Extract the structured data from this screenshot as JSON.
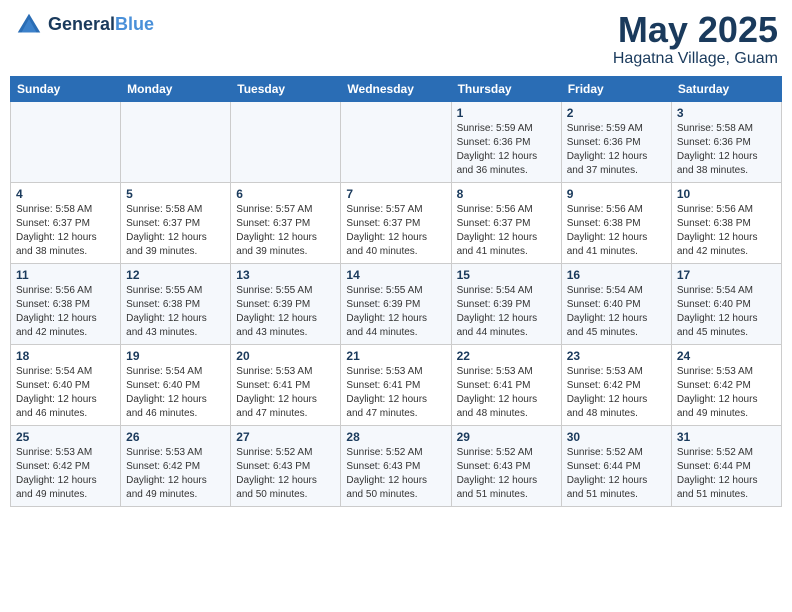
{
  "header": {
    "logo_line1": "General",
    "logo_line2": "Blue",
    "month": "May 2025",
    "location": "Hagatna Village, Guam"
  },
  "weekdays": [
    "Sunday",
    "Monday",
    "Tuesday",
    "Wednesday",
    "Thursday",
    "Friday",
    "Saturday"
  ],
  "weeks": [
    [
      {
        "day": "",
        "info": ""
      },
      {
        "day": "",
        "info": ""
      },
      {
        "day": "",
        "info": ""
      },
      {
        "day": "",
        "info": ""
      },
      {
        "day": "1",
        "info": "Sunrise: 5:59 AM\nSunset: 6:36 PM\nDaylight: 12 hours\nand 36 minutes."
      },
      {
        "day": "2",
        "info": "Sunrise: 5:59 AM\nSunset: 6:36 PM\nDaylight: 12 hours\nand 37 minutes."
      },
      {
        "day": "3",
        "info": "Sunrise: 5:58 AM\nSunset: 6:36 PM\nDaylight: 12 hours\nand 38 minutes."
      }
    ],
    [
      {
        "day": "4",
        "info": "Sunrise: 5:58 AM\nSunset: 6:37 PM\nDaylight: 12 hours\nand 38 minutes."
      },
      {
        "day": "5",
        "info": "Sunrise: 5:58 AM\nSunset: 6:37 PM\nDaylight: 12 hours\nand 39 minutes."
      },
      {
        "day": "6",
        "info": "Sunrise: 5:57 AM\nSunset: 6:37 PM\nDaylight: 12 hours\nand 39 minutes."
      },
      {
        "day": "7",
        "info": "Sunrise: 5:57 AM\nSunset: 6:37 PM\nDaylight: 12 hours\nand 40 minutes."
      },
      {
        "day": "8",
        "info": "Sunrise: 5:56 AM\nSunset: 6:37 PM\nDaylight: 12 hours\nand 41 minutes."
      },
      {
        "day": "9",
        "info": "Sunrise: 5:56 AM\nSunset: 6:38 PM\nDaylight: 12 hours\nand 41 minutes."
      },
      {
        "day": "10",
        "info": "Sunrise: 5:56 AM\nSunset: 6:38 PM\nDaylight: 12 hours\nand 42 minutes."
      }
    ],
    [
      {
        "day": "11",
        "info": "Sunrise: 5:56 AM\nSunset: 6:38 PM\nDaylight: 12 hours\nand 42 minutes."
      },
      {
        "day": "12",
        "info": "Sunrise: 5:55 AM\nSunset: 6:38 PM\nDaylight: 12 hours\nand 43 minutes."
      },
      {
        "day": "13",
        "info": "Sunrise: 5:55 AM\nSunset: 6:39 PM\nDaylight: 12 hours\nand 43 minutes."
      },
      {
        "day": "14",
        "info": "Sunrise: 5:55 AM\nSunset: 6:39 PM\nDaylight: 12 hours\nand 44 minutes."
      },
      {
        "day": "15",
        "info": "Sunrise: 5:54 AM\nSunset: 6:39 PM\nDaylight: 12 hours\nand 44 minutes."
      },
      {
        "day": "16",
        "info": "Sunrise: 5:54 AM\nSunset: 6:40 PM\nDaylight: 12 hours\nand 45 minutes."
      },
      {
        "day": "17",
        "info": "Sunrise: 5:54 AM\nSunset: 6:40 PM\nDaylight: 12 hours\nand 45 minutes."
      }
    ],
    [
      {
        "day": "18",
        "info": "Sunrise: 5:54 AM\nSunset: 6:40 PM\nDaylight: 12 hours\nand 46 minutes."
      },
      {
        "day": "19",
        "info": "Sunrise: 5:54 AM\nSunset: 6:40 PM\nDaylight: 12 hours\nand 46 minutes."
      },
      {
        "day": "20",
        "info": "Sunrise: 5:53 AM\nSunset: 6:41 PM\nDaylight: 12 hours\nand 47 minutes."
      },
      {
        "day": "21",
        "info": "Sunrise: 5:53 AM\nSunset: 6:41 PM\nDaylight: 12 hours\nand 47 minutes."
      },
      {
        "day": "22",
        "info": "Sunrise: 5:53 AM\nSunset: 6:41 PM\nDaylight: 12 hours\nand 48 minutes."
      },
      {
        "day": "23",
        "info": "Sunrise: 5:53 AM\nSunset: 6:42 PM\nDaylight: 12 hours\nand 48 minutes."
      },
      {
        "day": "24",
        "info": "Sunrise: 5:53 AM\nSunset: 6:42 PM\nDaylight: 12 hours\nand 49 minutes."
      }
    ],
    [
      {
        "day": "25",
        "info": "Sunrise: 5:53 AM\nSunset: 6:42 PM\nDaylight: 12 hours\nand 49 minutes."
      },
      {
        "day": "26",
        "info": "Sunrise: 5:53 AM\nSunset: 6:42 PM\nDaylight: 12 hours\nand 49 minutes."
      },
      {
        "day": "27",
        "info": "Sunrise: 5:52 AM\nSunset: 6:43 PM\nDaylight: 12 hours\nand 50 minutes."
      },
      {
        "day": "28",
        "info": "Sunrise: 5:52 AM\nSunset: 6:43 PM\nDaylight: 12 hours\nand 50 minutes."
      },
      {
        "day": "29",
        "info": "Sunrise: 5:52 AM\nSunset: 6:43 PM\nDaylight: 12 hours\nand 51 minutes."
      },
      {
        "day": "30",
        "info": "Sunrise: 5:52 AM\nSunset: 6:44 PM\nDaylight: 12 hours\nand 51 minutes."
      },
      {
        "day": "31",
        "info": "Sunrise: 5:52 AM\nSunset: 6:44 PM\nDaylight: 12 hours\nand 51 minutes."
      }
    ]
  ]
}
